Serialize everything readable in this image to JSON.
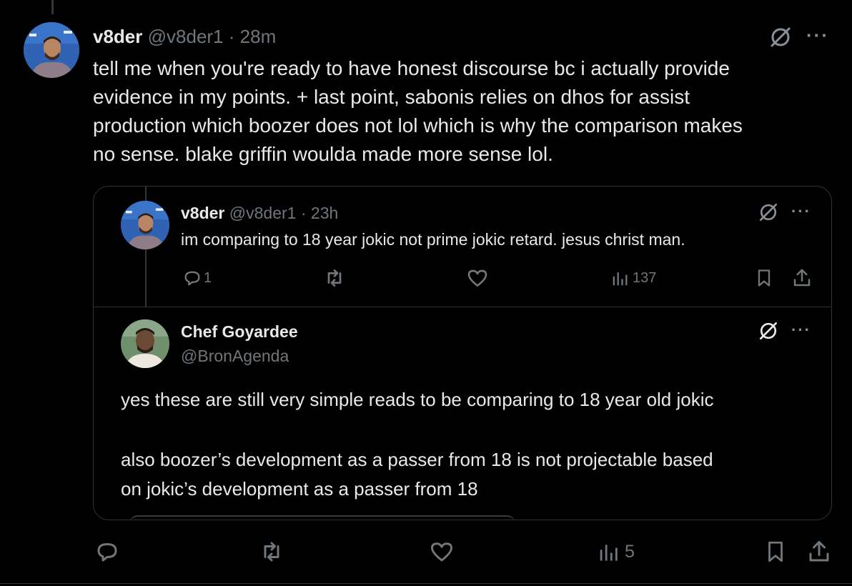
{
  "main_post": {
    "display_name": "v8der",
    "handle": "@v8der1",
    "separator": "·",
    "time": "28m",
    "text": "tell me when you're ready to have honest discourse bc i actually provide\nevidence in my points. + last point, sabonis relies on dhos for assist\nproduction which boozer does not lol which is why the comparison makes\nno sense. blake griffin woulda made more sense lol.",
    "actions": {
      "views": "5"
    }
  },
  "quoted_post": {
    "display_name": "v8der",
    "handle": "@v8der1",
    "separator": "·",
    "time": "23h",
    "text": "im comparing to 18 year jokic not prime jokic retard. jesus christ man.",
    "actions": {
      "replies": "1",
      "views": "137"
    }
  },
  "quoted_reply": {
    "display_name": "Chef Goyardee",
    "handle": "@BronAgenda",
    "text_1": "yes these are still very simple reads to be comparing to 18 year old jokic",
    "text_2": "also boozer’s development as a passer from 18 is not projectable based\non jokic’s development as a passer from 18"
  },
  "more_glyph": "···",
  "icons": {
    "grok": "grok-slash-icon",
    "more": "more-dots-icon",
    "reply": "reply-bubble-icon",
    "repost": "repost-icon",
    "like": "heart-icon",
    "views": "views-bars-icon",
    "bookmark": "bookmark-icon",
    "share": "share-upload-icon"
  },
  "colors": {
    "background": "#000000",
    "text": "#e7e9ea",
    "muted": "#71767b",
    "border": "#2f3336",
    "avatar_bg": "#2d5aa6"
  }
}
